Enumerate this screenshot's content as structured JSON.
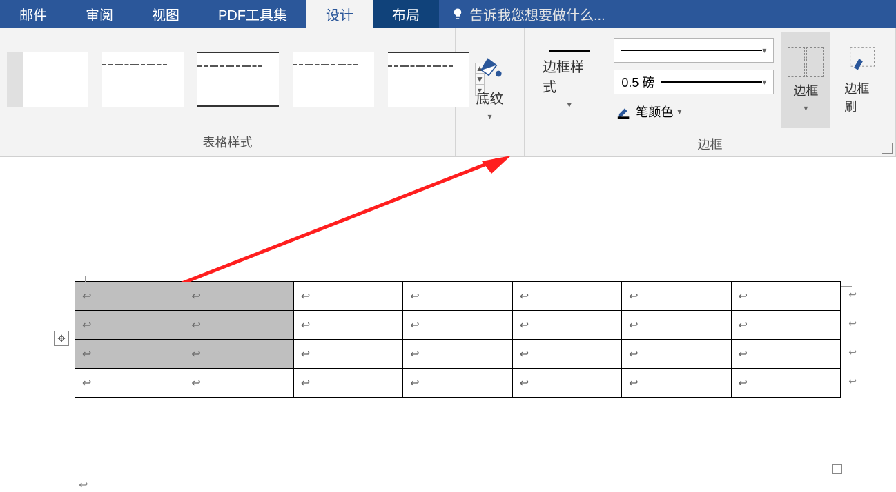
{
  "tabs": {
    "mail": "邮件",
    "review": "审阅",
    "view": "视图",
    "pdf": "PDF工具集",
    "design": "设计",
    "layout": "布局"
  },
  "tell_me": {
    "placeholder": "告诉我您想要做什么..."
  },
  "ribbon": {
    "styles_label": "表格样式",
    "shading_label": "底纹",
    "border_style_label": "边框样式",
    "line_weight": "0.5 磅",
    "pen_color_label": "笔颜色",
    "borders_group_label": "边框",
    "borders_btn": "边框",
    "painter_btn": "边框刷"
  },
  "glyphs": {
    "caret": "▾",
    "up": "▲",
    "down": "▼",
    "more": "▾",
    "move": "✥",
    "pilcrow": "↩"
  }
}
